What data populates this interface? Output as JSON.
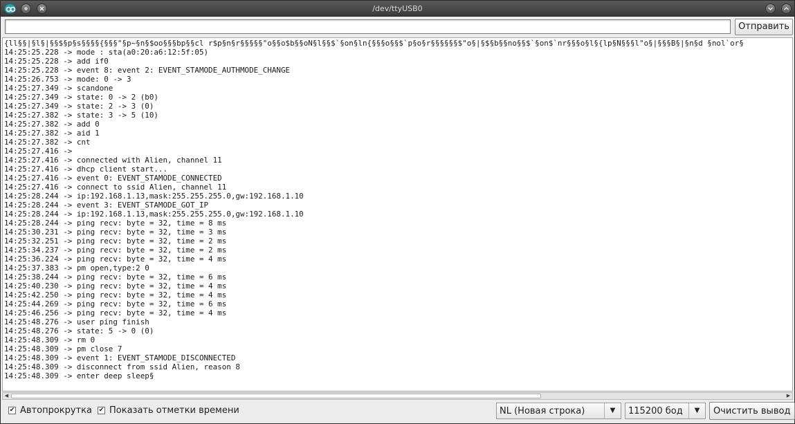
{
  "window": {
    "title": "/dev/ttyUSB0",
    "icons": {
      "app": "arduino-icon",
      "minimize": "minimize-icon",
      "close": "close-icon",
      "menu": "chevron-down-icon",
      "maximize": "chevron-up-icon"
    }
  },
  "send": {
    "input_value": "",
    "button_label": "Отправить"
  },
  "console": {
    "lines": [
      "{ll§§|§l§|§§$§p§s§§§§{§§§\"§p~§n§$oo§§§bp§§cl r$p§n§r§§§§§\"o§§o$b§§oN§l§§$`§on§ln{§§§o§§$`p§o§r§§§§§§$\"o§|§$§b§§no§§$`§on$`nr§§§o§l§{lp§N§§§l\"o§|§§§B§|§n§d §nol`or§",
      "14:25:25.228 -> mode : sta(a0:20:a6:12:5f:05)",
      "14:25:25.228 -> add if0",
      "14:25:25.228 -> event 8: event 2: EVENT_STAMODE_AUTHMODE_CHANGE",
      "14:25:26.753 -> mode: 0 -> 3",
      "14:25:27.349 -> scandone",
      "14:25:27.349 -> state: 0 -> 2 (b0)",
      "14:25:27.349 -> state: 2 -> 3 (0)",
      "14:25:27.382 -> state: 3 -> 5 (10)",
      "14:25:27.382 -> add 0",
      "14:25:27.382 -> aid 1",
      "14:25:27.382 -> cnt",
      "14:25:27.416 -> ",
      "14:25:27.416 -> connected with Alien, channel 11",
      "14:25:27.416 -> dhcp client start...",
      "14:25:27.416 -> event 0: EVENT_STAMODE_CONNECTED",
      "14:25:27.416 -> connect to ssid Alien, channel 11",
      "14:25:28.244 -> ip:192.168.1.13,mask:255.255.255.0,gw:192.168.1.10",
      "14:25:28.244 -> event 3: EVENT_STAMODE_GOT_IP",
      "14:25:28.244 -> ip:192.168.1.13,mask:255.255.255.0,gw:192.168.1.10",
      "14:25:28.244 -> ping recv: byte = 32, time = 8 ms",
      "14:25:30.231 -> ping recv: byte = 32, time = 3 ms",
      "14:25:32.251 -> ping recv: byte = 32, time = 2 ms",
      "14:25:34.237 -> ping recv: byte = 32, time = 2 ms",
      "14:25:36.224 -> ping recv: byte = 32, time = 4 ms",
      "14:25:37.383 -> pm open,type:2 0",
      "14:25:38.244 -> ping recv: byte = 32, time = 6 ms",
      "14:25:40.230 -> ping recv: byte = 32, time = 4 ms",
      "14:25:42.250 -> ping recv: byte = 32, time = 4 ms",
      "14:25:44.269 -> ping recv: byte = 32, time = 6 ms",
      "14:25:46.256 -> ping recv: byte = 32, time = 4 ms",
      "14:25:48.276 -> user ping finish",
      "14:25:48.276 -> state: 5 -> 0 (0)",
      "14:25:48.309 -> rm 0",
      "14:25:48.309 -> pm close 7",
      "14:25:48.309 -> event 1: EVENT_STAMODE_DISCONNECTED",
      "14:25:48.309 -> disconnect from ssid Alien, reason 8",
      "14:25:48.309 -> enter deep sleep§"
    ]
  },
  "scroll": {
    "left_arrow": "◀",
    "right_arrow": "▶"
  },
  "bottom": {
    "autoscroll_checked": true,
    "autoscroll_label": "Автопрокрутка",
    "timestamps_checked": true,
    "timestamps_label": "Показать отметки времени",
    "line_ending": "NL (Новая строка)",
    "baud_rate": "115200 бод",
    "clear_label": "Очистить вывод",
    "check_mark": "✔",
    "drop_arrow": "▼"
  }
}
